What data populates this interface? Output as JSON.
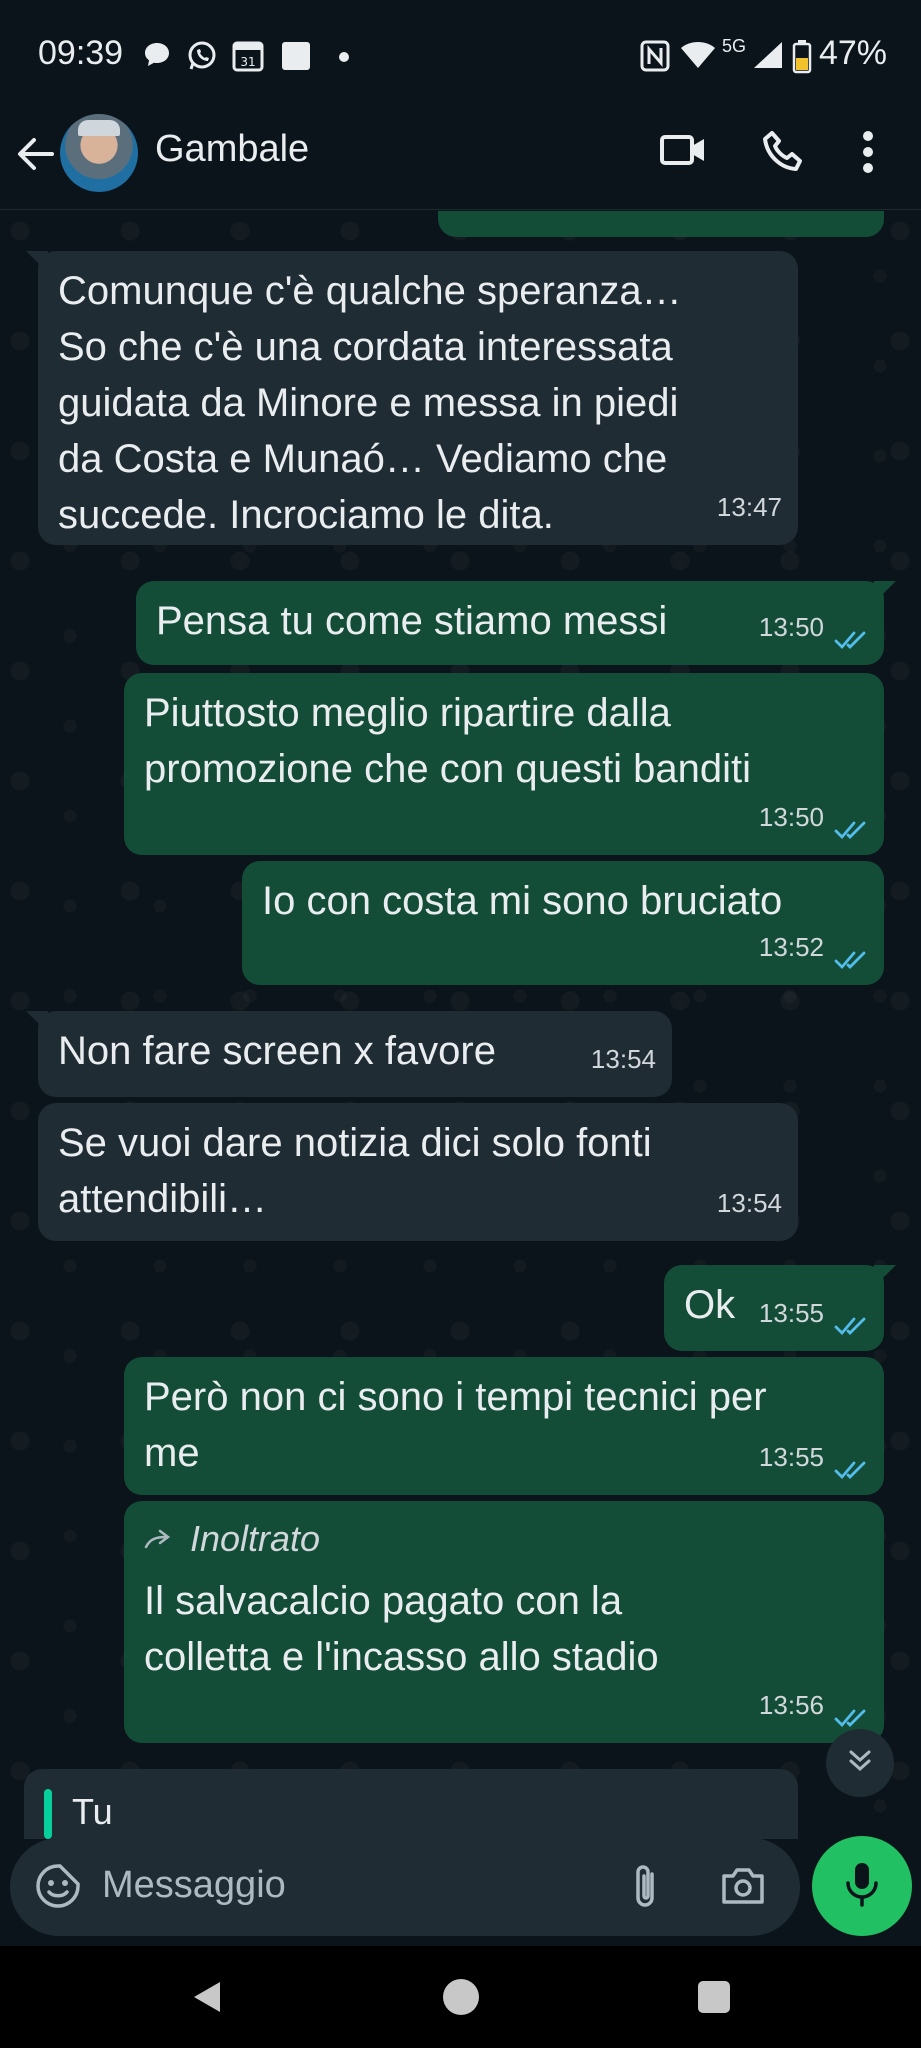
{
  "status_bar": {
    "time": "09:39",
    "network": "5G",
    "battery": "47%",
    "icons": [
      "chat-bubble-icon",
      "whatsapp-icon",
      "calendar-icon",
      "square-icon",
      "dot-icon",
      "nfc-icon",
      "wifi-icon",
      "signal-icon",
      "battery-icon"
    ],
    "calendar_day": "31"
  },
  "header": {
    "contact_name": "Gambale",
    "icons": [
      "back-arrow-icon",
      "video-call-icon",
      "phone-icon",
      "more-vert-icon"
    ]
  },
  "messages": [
    {
      "dir": "in",
      "text": "Comunque c'è qualche speranza…\nSo che c'è una cordata interessata\nguidata da Minore e messa in piedi\nda Costa e Munaó… Vediamo che\nsuccede. Incrociamo le dita.",
      "time": "13:47"
    },
    {
      "dir": "out",
      "text": "Pensa tu come stiamo messi",
      "time": "13:50"
    },
    {
      "dir": "out",
      "text": "Piuttosto meglio ripartire dalla\npromozione che con questi banditi",
      "time": "13:50"
    },
    {
      "dir": "out",
      "text": "Io con costa mi sono bruciato",
      "time": "13:52"
    },
    {
      "dir": "in",
      "text": "Non fare screen x favore",
      "time": "13:54"
    },
    {
      "dir": "in",
      "text": "Se vuoi dare notizia dici solo fonti\nattendibili…",
      "time": "13:54"
    },
    {
      "dir": "out",
      "text": "Ok",
      "time": "13:55"
    },
    {
      "dir": "out",
      "text": "Però non ci sono i tempi tecnici per\nme",
      "time": "13:55"
    },
    {
      "dir": "out",
      "forwarded_label": "Inoltrato",
      "text": "Il salvacalcio pagato con la\ncolletta e l'incasso allo stadio",
      "time": "13:56"
    }
  ],
  "reply_preview": {
    "name": "Tu"
  },
  "composer": {
    "placeholder": "Messaggio"
  },
  "colors": {
    "incoming": "#1f2c34",
    "outgoing": "#134d37",
    "read_ticks": "#53bdeb",
    "mic": "#21c063"
  }
}
